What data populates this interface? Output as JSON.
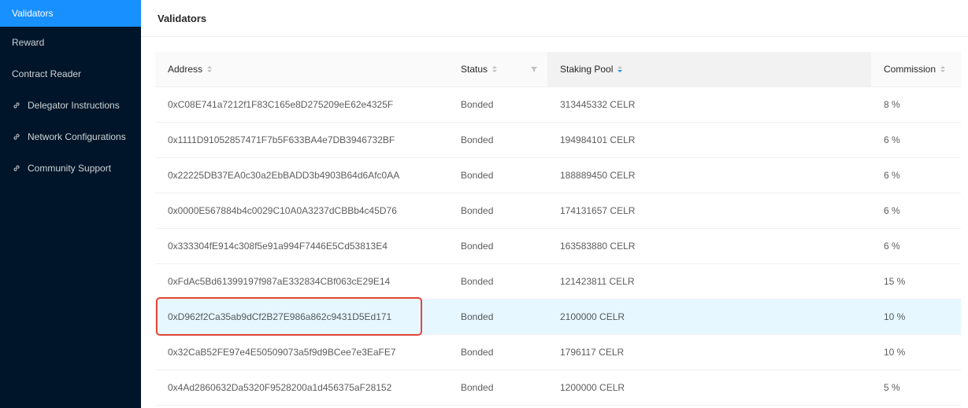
{
  "sidebar": {
    "items": [
      {
        "label": "Validators",
        "icon": "",
        "active": true
      },
      {
        "label": "Reward",
        "icon": ""
      },
      {
        "label": "Contract Reader",
        "icon": ""
      },
      {
        "label": "Delegator Instructions",
        "icon": "link-icon"
      },
      {
        "label": "Network Configurations",
        "icon": "link-icon"
      },
      {
        "label": "Community Support",
        "icon": "link-icon"
      }
    ]
  },
  "header": {
    "title": "Validators"
  },
  "table": {
    "columns": [
      "Address",
      "Status",
      "Staking Pool",
      "Commission"
    ],
    "sorted_column": "Staking Pool",
    "rows": [
      {
        "address": "0xC08E741a7212f1F83C165e8D275209eE62e4325F",
        "status": "Bonded",
        "pool": "313445332 CELR",
        "commission": "8 %"
      },
      {
        "address": "0x1111D91052857471F7b5F633BA4e7DB3946732BF",
        "status": "Bonded",
        "pool": "194984101 CELR",
        "commission": "6 %"
      },
      {
        "address": "0x22225DB37EA0c30a2EbBADD3b4903B64d6Afc0AA",
        "status": "Bonded",
        "pool": "188889450 CELR",
        "commission": "6 %"
      },
      {
        "address": "0x0000E567884b4c0029C10A0A3237dCBBb4c45D76",
        "status": "Bonded",
        "pool": "174131657 CELR",
        "commission": "6 %"
      },
      {
        "address": "0x333304fE914c308f5e91a994F7446E5Cd53813E4",
        "status": "Bonded",
        "pool": "163583880 CELR",
        "commission": "6 %"
      },
      {
        "address": "0xFdAc5Bd61399197f987aE332834CBf063cE29E14",
        "status": "Bonded",
        "pool": "121423811 CELR",
        "commission": "15 %"
      },
      {
        "address": "0xD962f2Ca35ab9dCf2B27E986a862c9431D5Ed171",
        "status": "Bonded",
        "pool": "2100000 CELR",
        "commission": "10 %"
      },
      {
        "address": "0x32CaB52FE97e4E50509073a5f9d9BCee7e3EaFE7",
        "status": "Bonded",
        "pool": "1796117 CELR",
        "commission": "10 %"
      },
      {
        "address": "0x4Ad2860632Da5320F9528200a1d456375aF28152",
        "status": "Bonded",
        "pool": "1200000 CELR",
        "commission": "5 %"
      }
    ],
    "highlighted_row": 6
  },
  "colors": {
    "sidebar_bg": "#001529",
    "active_item": "#1890ff",
    "highlight_row": "#e6f7ff",
    "annotation_border": "#e0473a"
  }
}
